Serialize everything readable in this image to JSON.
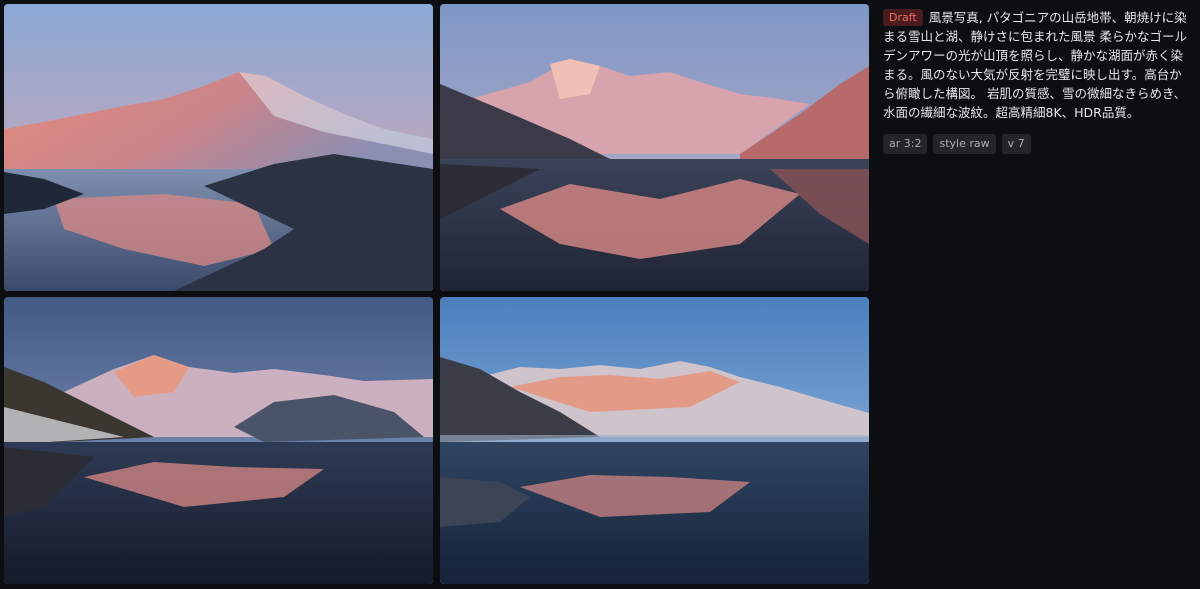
{
  "prompt": {
    "badge": "Draft",
    "text": "風景写真, パタゴニアの山岳地帯、朝焼けに染まる雪山と湖、静けさに包まれた風景 柔らかなゴールデンアワーの光が山頂を照らし、静かな湖面が赤く染まる。風のない大気が反射を完璧に映し出す。高台から俯瞰した構図。 岩肌の質感、雪の微細なきらめき、水面の繊細な波紋。超高精細8K、HDR品質。"
  },
  "tags": [
    "ar 3:2",
    "style raw",
    "v 7"
  ],
  "colors": {
    "background": "#0d0e11",
    "badge_bg": "#4a1c1e",
    "badge_text": "#ef6a63",
    "tag_bg": "#23252b",
    "alpenglow": "#e8907a",
    "sky_top": "#7ea7d8"
  }
}
